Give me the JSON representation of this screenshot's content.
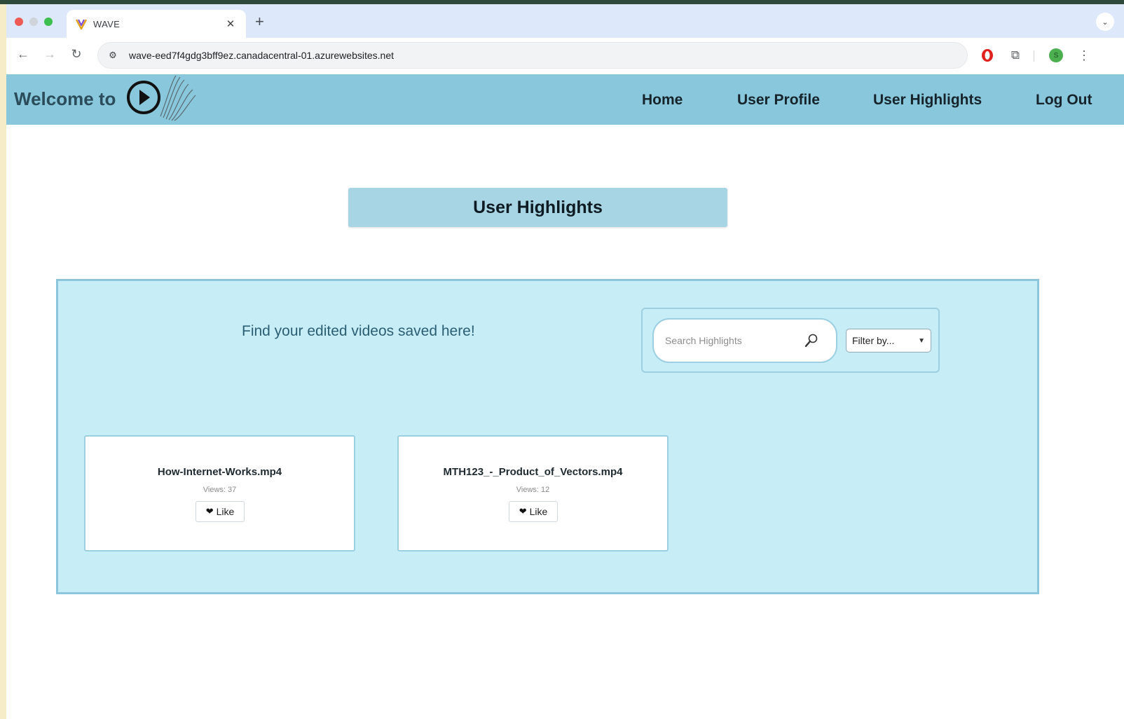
{
  "browser": {
    "tab_title": "WAVE",
    "url": "wave-eed7f4gdg3bff9ez.canadacentral-01.azurewebsites.net",
    "profile_initial": "S"
  },
  "header": {
    "brand_text": "Welcome to",
    "logo_alt": "WAVE",
    "nav": [
      "Home",
      "User Profile",
      "User Highlights",
      "Log Out"
    ]
  },
  "main": {
    "title": "User Highlights",
    "subtitle": "Find your edited videos saved here!",
    "search": {
      "placeholder": "Search Highlights",
      "value": ""
    },
    "filter": {
      "selected": "Filter by..."
    },
    "videos": [
      {
        "name": "How-Internet-Works.mp4",
        "views": "Views: 37",
        "like_label": "Like"
      },
      {
        "name": "MTH123_-_Product_of_Vectors.mp4",
        "views": "Views: 12",
        "like_label": "Like"
      }
    ]
  },
  "colors": {
    "header_bg": "#89c8dc",
    "panel_bg": "#c7eef7",
    "title_box_bg": "#a8d5e3",
    "browser_tabbar": "#dde8fa"
  }
}
